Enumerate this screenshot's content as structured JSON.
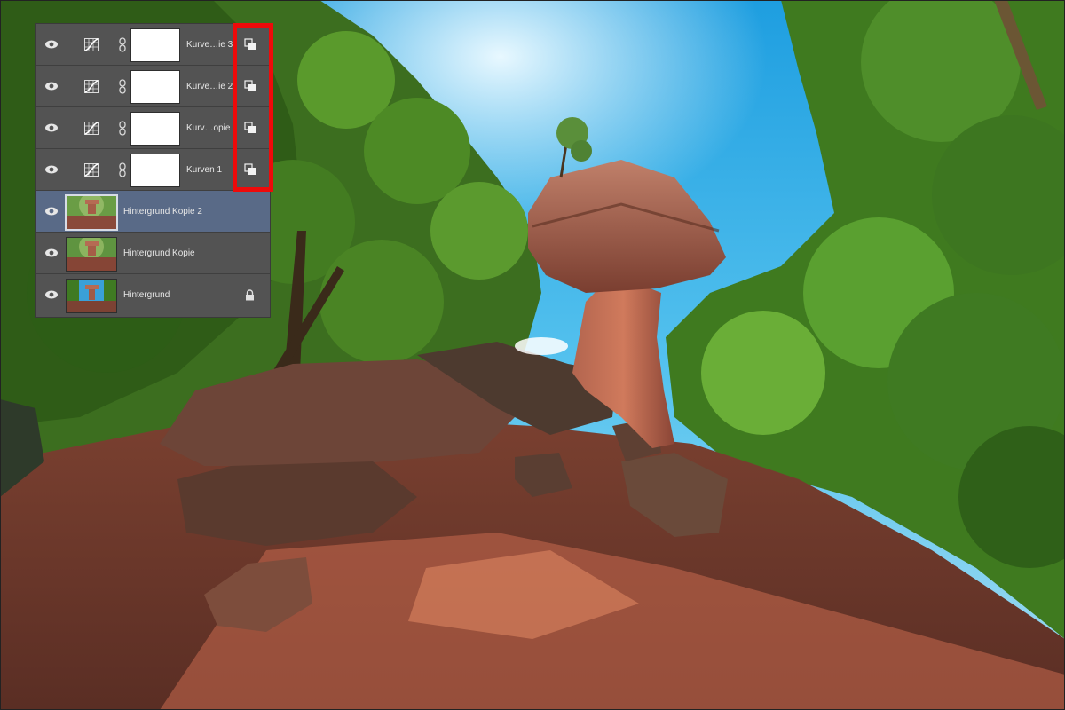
{
  "layers_panel": {
    "layers": [
      {
        "name": "Kurve…ie 3",
        "kind": "curves",
        "clipped": true,
        "visible": true
      },
      {
        "name": "Kurve…ie 2",
        "kind": "curves",
        "clipped": true,
        "visible": true
      },
      {
        "name": "Kurv…opie",
        "kind": "curves",
        "clipped": true,
        "visible": true
      },
      {
        "name": "Kurven 1",
        "kind": "curves",
        "clipped": true,
        "visible": true
      },
      {
        "name": "Hintergrund Kopie 2",
        "kind": "pixel",
        "selected": true,
        "visible": true
      },
      {
        "name": "Hintergrund Kopie",
        "kind": "pixel",
        "visible": true
      },
      {
        "name": "Hintergrund",
        "kind": "pixel",
        "locked": true,
        "visible": true
      }
    ]
  },
  "icons": {
    "visibility": "eye-icon",
    "adjustment": "curves-adjustment-icon",
    "link": "chain-link-icon",
    "clipping": "clipping-mask-icon",
    "lock": "lock-icon"
  },
  "colors": {
    "panel_bg": "#535353",
    "selected_row": "#596a87",
    "highlight": "#ee0a0a",
    "sky": "#35b4ea",
    "foliage": "#3f7d22",
    "rock": "#a9604a"
  }
}
